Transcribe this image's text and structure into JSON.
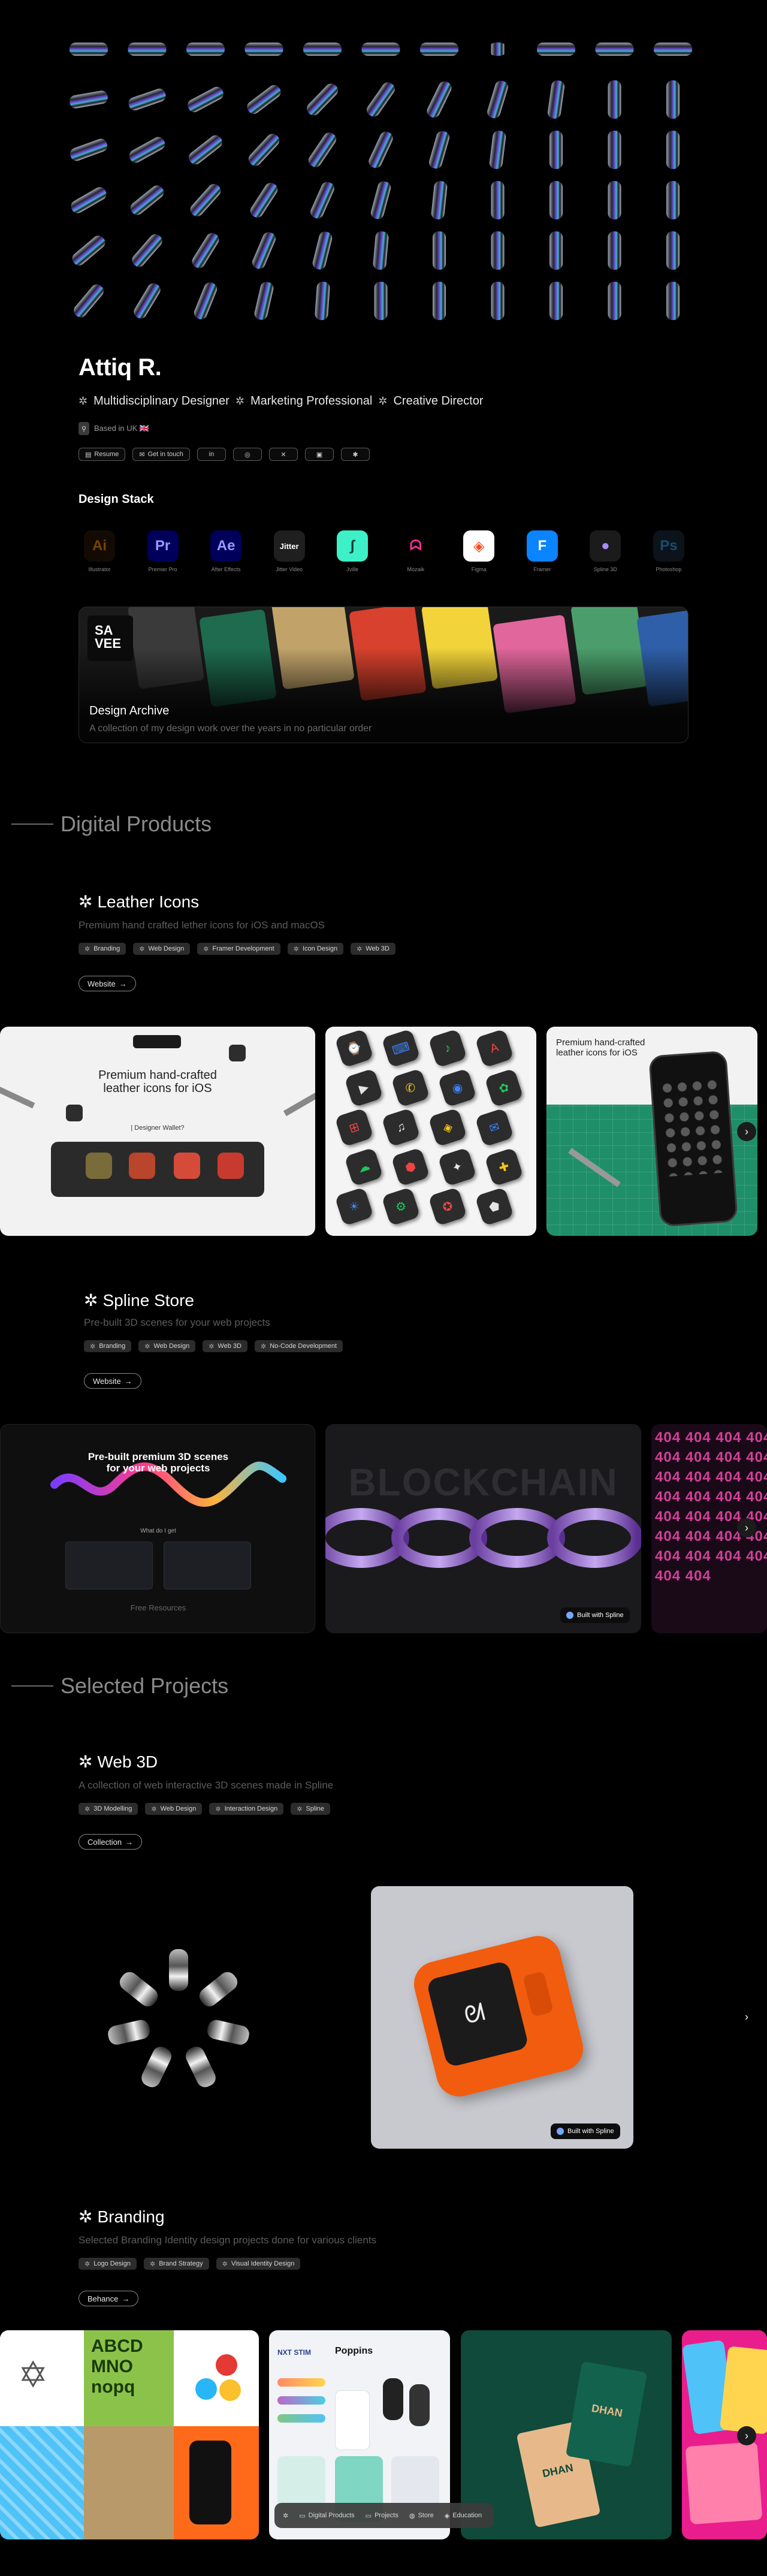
{
  "profile": {
    "name": "Attiq R.",
    "roles": [
      "Multidisciplinary Designer",
      "Marketing Professional",
      "Creative Director"
    ],
    "location": "Based in UK 🇬🇧"
  },
  "links": [
    {
      "label": "Resume",
      "icon": "document-icon"
    },
    {
      "label": "Get in touch",
      "icon": "mail-icon"
    },
    {
      "label": "in",
      "icon": "linkedin-icon"
    },
    {
      "label": "◎",
      "icon": "instagram-icon"
    },
    {
      "label": "✕",
      "icon": "x-icon"
    },
    {
      "label": "▣",
      "icon": "read-cv-icon"
    },
    {
      "label": "✱",
      "icon": "dribbble-icon"
    }
  ],
  "stack": {
    "title": "Design Stack",
    "tools": [
      {
        "abbr": "Ai",
        "label": "Illustrator",
        "bg": "#2b1a08",
        "fg": "#ff9a00"
      },
      {
        "abbr": "Pr",
        "label": "Premier Pro",
        "bg": "#00005b",
        "fg": "#9999ff"
      },
      {
        "abbr": "Ae",
        "label": "After Effects",
        "bg": "#00005b",
        "fg": "#9999ff"
      },
      {
        "abbr": "Jitter",
        "label": "Jitter Video",
        "bg": "#1f1f1f",
        "fg": "#ffffff"
      },
      {
        "abbr": "∫",
        "label": "Jville",
        "bg": "#3ef0c7",
        "fg": "#0b3a30"
      },
      {
        "abbr": "ᗣ",
        "label": "Mozaik",
        "bg": "#000000",
        "fg": "#ff2d92"
      },
      {
        "abbr": "◈",
        "label": "Figma",
        "bg": "#ffffff",
        "fg": "#f24e1e"
      },
      {
        "abbr": "F",
        "label": "Framer",
        "bg": "#0a84ff",
        "fg": "#ffffff"
      },
      {
        "abbr": "●",
        "label": "Spline 3D",
        "bg": "#1b1b1b",
        "fg": "#a78bfa"
      },
      {
        "abbr": "Ps",
        "label": "Photoshop",
        "bg": "#1c2a3a",
        "fg": "#31a8ff"
      }
    ]
  },
  "archive": {
    "logo": "SA\nVEE",
    "title": "Design Archive",
    "subtitle": "A collection of my design work over the years in no particular order"
  },
  "sections": {
    "digital": "Digital Products",
    "selected": "Selected Projects"
  },
  "leather": {
    "title": "Leather Icons",
    "subtitle": "Premium hand crafted lether icons for iOS and macOS",
    "tags": [
      "Branding",
      "Web Design",
      "Framer Development",
      "Icon Design",
      "Web 3D"
    ],
    "button": "Website",
    "card1": {
      "heading": "Premium hand-crafted\nleather icons for iOS",
      "cta": "Designer Wallet?"
    },
    "card3": {
      "heading": "Premium hand-crafted\nleather icons for iOS"
    }
  },
  "spline": {
    "title": "Spline Store",
    "subtitle": "Pre-built 3D scenes for your web projects",
    "tags": [
      "Branding",
      "Web Design",
      "Web 3D",
      "No-Code Development"
    ],
    "button": "Website",
    "card1": {
      "heading": "Pre-built premium 3D scenes\nfor your web projects",
      "label": "What do I get",
      "footer": "Free Resources"
    },
    "card2": {
      "word": "BLOCKCHAIN",
      "badge": "Built with Spline"
    },
    "card3": {
      "word": "404 404 404"
    }
  },
  "web3d": {
    "title": "Web 3D",
    "subtitle": "A collection of web interactive 3D scenes made in Spline",
    "tags": [
      "3D Modelling",
      "Web Design",
      "Interaction Design",
      "Spline"
    ],
    "button": "Collection",
    "badge": "Built with Spline"
  },
  "branding": {
    "title": "Branding",
    "subtitle": "Selected Branding Identity design projects done for various clients",
    "tags": [
      "Logo Design",
      "Brand Strategy",
      "Visual Identity Design"
    ],
    "button": "Behance",
    "letters": "ABCD\nMNO\nnopq",
    "card2": {
      "brand": "NXT STIM",
      "app": "Poppins"
    },
    "card3": {
      "brand": "DHAN"
    }
  },
  "dock": [
    "Digital Products",
    "Projects",
    "Store",
    "Education"
  ],
  "colors": {
    "accent": "#ffffff",
    "muted": "#5c5c5c",
    "tag_bg": "#2c2c2c"
  }
}
